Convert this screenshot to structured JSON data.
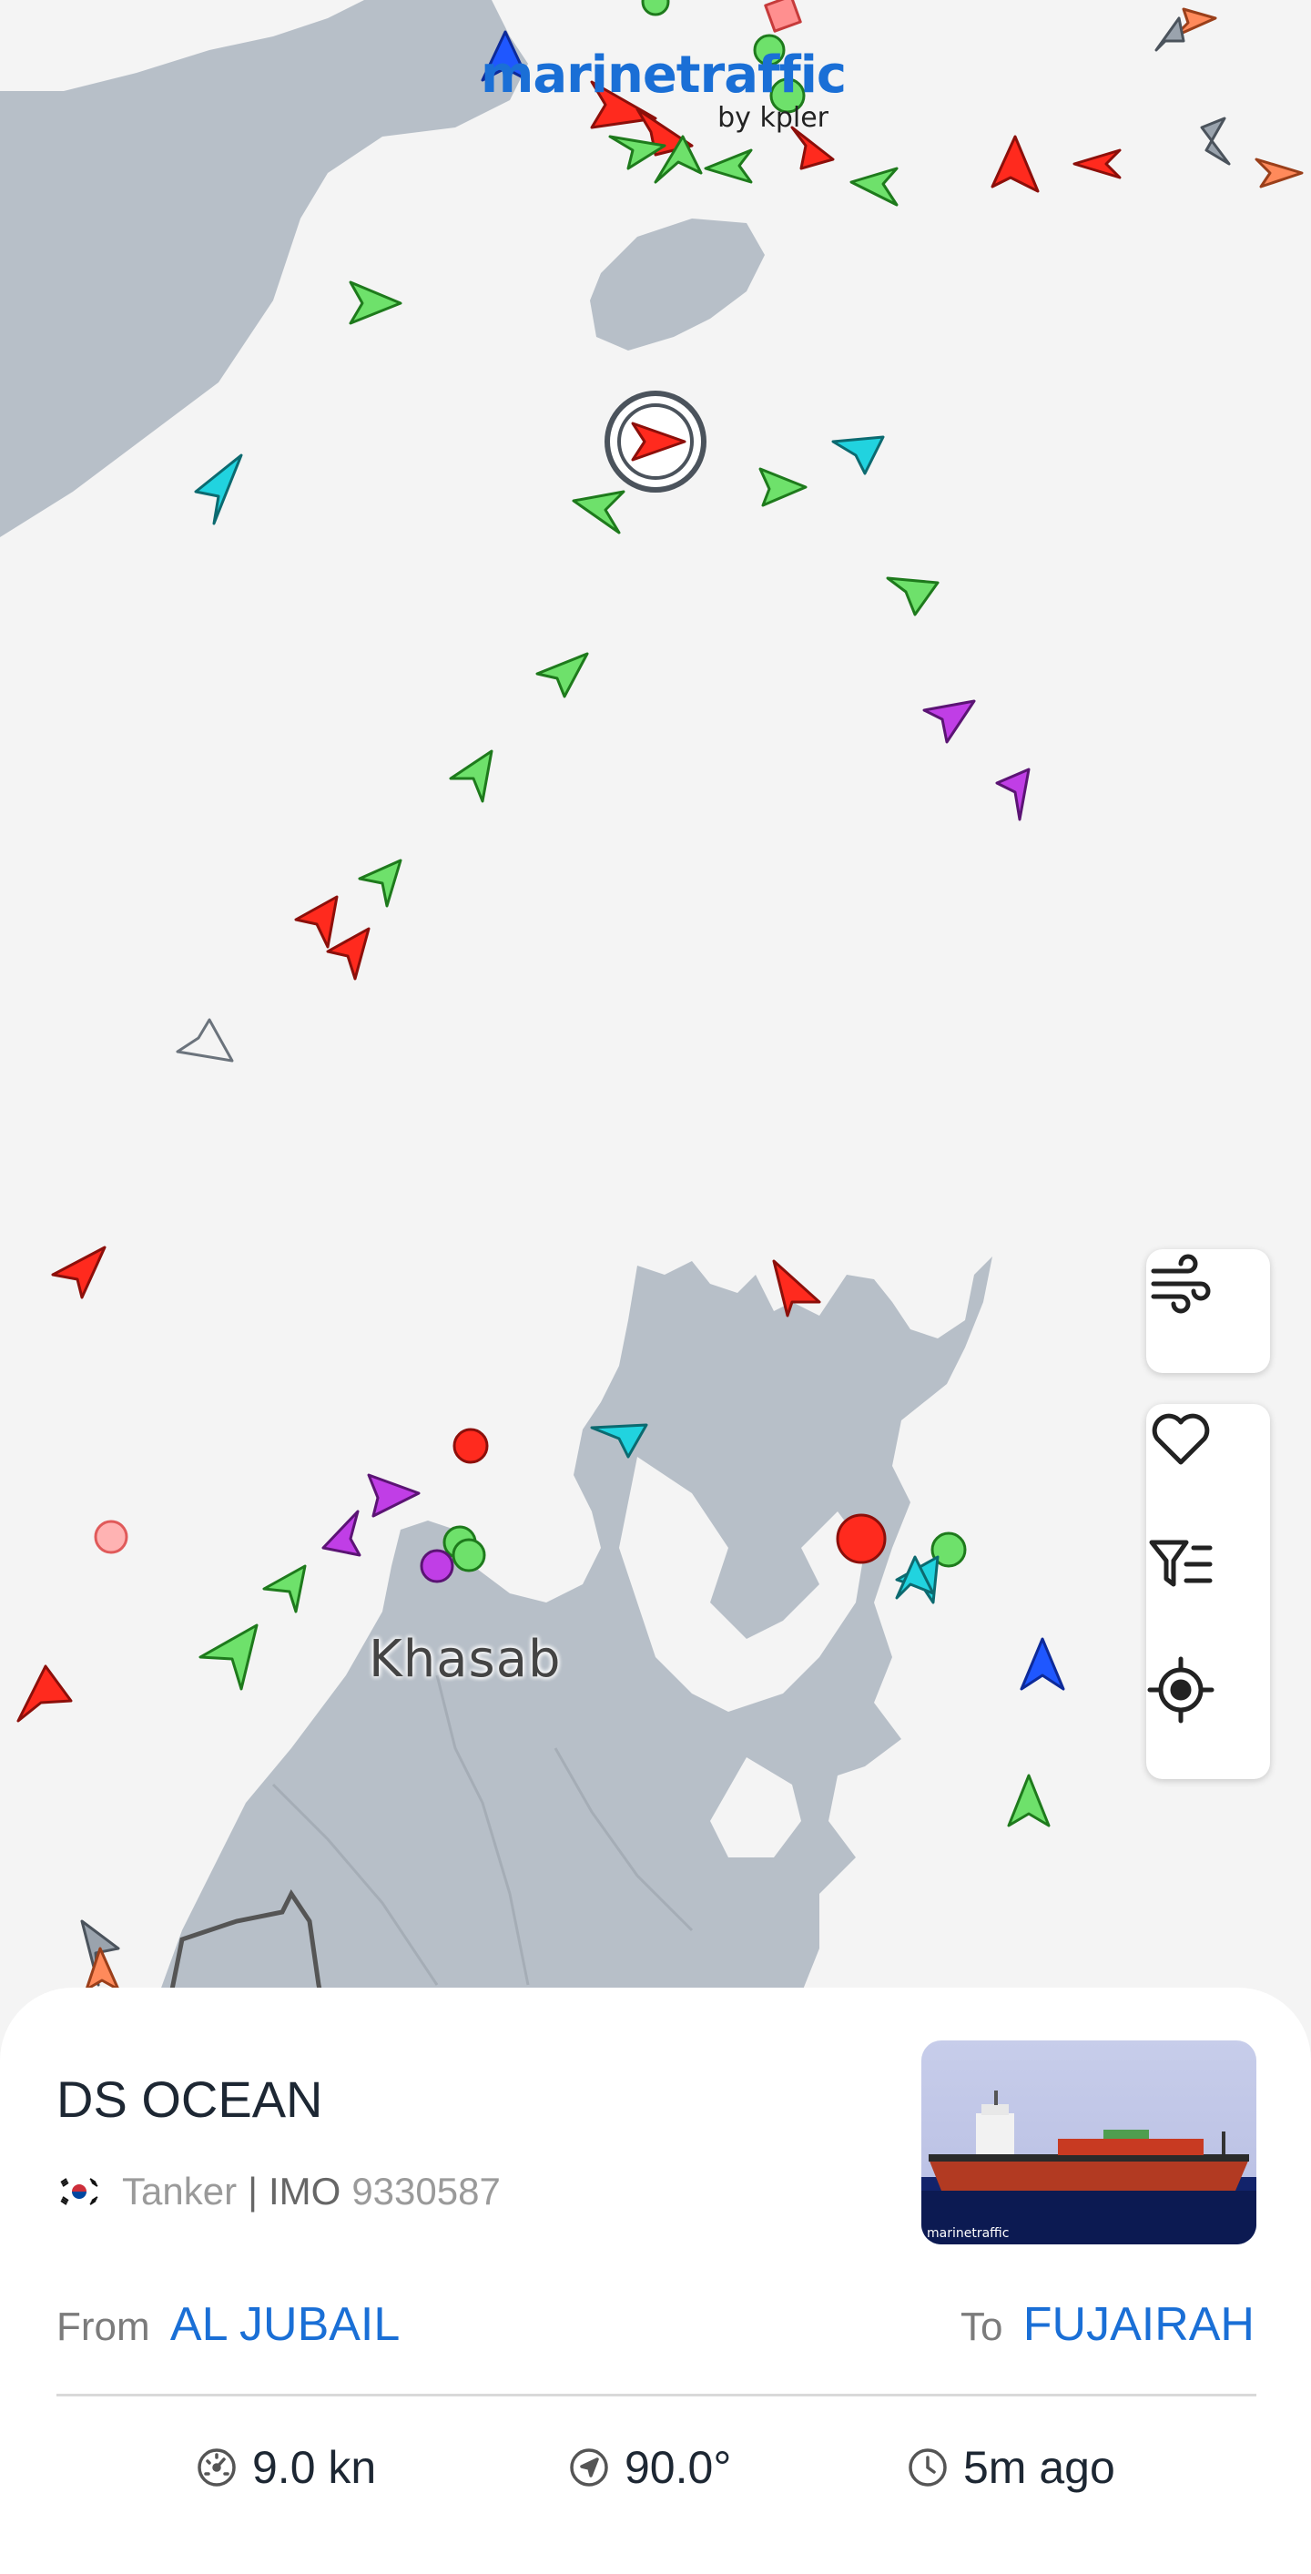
{
  "app": {
    "logo_word": "marinetraffic",
    "logo_by": "by kpler"
  },
  "map": {
    "place_label": "Khasab",
    "colors": {
      "water": "#f4f4f4",
      "land": "#b7bfc8",
      "cargo_green": "#6ee16b",
      "tanker_red": "#ff2a1e",
      "passenger_cyan": "#21d3df",
      "pleasure_magenta": "#c03ee6",
      "tug_blue": "#1f57ff",
      "unknown_grey": "#9aa3ad",
      "fishing_orange": "#ff8a5b"
    },
    "controls": [
      {
        "name": "weather-wind-icon"
      },
      {
        "name": "favorite-heart-icon"
      },
      {
        "name": "filter-list-icon"
      },
      {
        "name": "locate-target-icon"
      }
    ]
  },
  "vessel": {
    "name": "DS OCEAN",
    "flag_icon": "south-korea-flag",
    "type": "Tanker",
    "imo_label": "IMO",
    "imo": "9330587",
    "separator": "|",
    "from_label": "From",
    "from_port": "AL JUBAIL",
    "to_label": "To",
    "to_port": "FUJAIRAH",
    "speed": "9.0 kn",
    "course": "90.0°",
    "last_seen": "5m ago",
    "photo_watermark": "marinetraffic"
  }
}
